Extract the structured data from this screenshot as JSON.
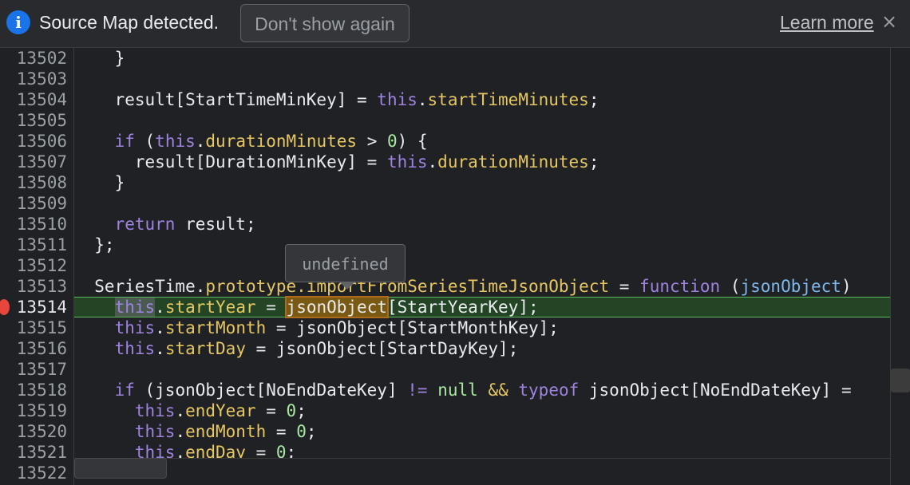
{
  "infobar": {
    "icon": "info-icon",
    "message": "Source Map detected.",
    "dont_show_label": "Don't show again",
    "learn_more_label": "Learn more",
    "close_glyph": "×"
  },
  "editor": {
    "current_line": "13514",
    "tooltip": "undefined",
    "line_numbers": [
      "13502",
      "13503",
      "13504",
      "13505",
      "13506",
      "13507",
      "13508",
      "13509",
      "13510",
      "13511",
      "13512",
      "13513",
      "13514",
      "13515",
      "13516",
      "13517",
      "13518",
      "13519",
      "13520",
      "13521",
      "13522"
    ],
    "lines": {
      "l13502": "    }",
      "l13504a": "    result[StartTimeMinKey] = ",
      "l13504b": "this",
      "l13504c": ".",
      "l13504d": "startTimeMinutes",
      "l13504e": ";",
      "l13506a": "    ",
      "l13506b": "if",
      "l13506c": " (",
      "l13506d": "this",
      "l13506e": ".",
      "l13506f": "durationMinutes",
      "l13506g": " > ",
      "l13506h": "0",
      "l13506i": ") {",
      "l13507a": "      result[DurationMinKey] = ",
      "l13507b": "this",
      "l13507c": ".",
      "l13507d": "durationMinutes",
      "l13507e": ";",
      "l13508": "    }",
      "l13510a": "    ",
      "l13510b": "return",
      "l13510c": " result;",
      "l13511": "  };",
      "l13513a": "  SeriesTime.",
      "l13513b": "prototype",
      "l13513c": ".importFromSeriesTimeJsonObject",
      "l13513d": " = ",
      "l13513e": "function",
      "l13513f": " (",
      "l13513g": "jsonObject",
      "l13513h": ")",
      "l13514a": "    ",
      "l13514b": "this",
      "l13514c": ".",
      "l13514d": "startYear",
      "l13514e": " = ",
      "l13514f": "jsonObject",
      "l13514g": "[StartYearKey];",
      "l13515a": "    ",
      "l13515b": "this",
      "l13515c": ".",
      "l13515d": "startMonth",
      "l13515e": " = jsonObject[StartMonthKey];",
      "l13516a": "    ",
      "l13516b": "this",
      "l13516c": ".",
      "l13516d": "startDay",
      "l13516e": " = jsonObject[StartDayKey];",
      "l13518a": "    ",
      "l13518b": "if",
      "l13518c": " (jsonObject[NoEndDateKey] ",
      "l13518d": "!=",
      "l13518e": " ",
      "l13518f": "null",
      "l13518g": " ",
      "l13518h": "&&",
      "l13518i": " ",
      "l13518j": "typeof",
      "l13518k": " jsonObject[NoEndDateKey] ",
      "l13518l": "=",
      "l13519a": "      ",
      "l13519b": "this",
      "l13519c": ".",
      "l13519d": "endYear",
      "l13519e": " = ",
      "l13519f": "0",
      "l13519g": ";",
      "l13520a": "      ",
      "l13520b": "this",
      "l13520c": ".",
      "l13520d": "endMonth",
      "l13520e": " = ",
      "l13520f": "0",
      "l13520g": ";",
      "l13521a": "      ",
      "l13521b": "this",
      "l13521c": ".",
      "l13521d": "endDay",
      "l13521e": " = ",
      "l13521f": "0",
      "l13521g": ";"
    }
  },
  "colors": {
    "keyword": "#9e83e0",
    "property": "#e6c761",
    "number": "#a8e9a0",
    "param": "#7fb8ee",
    "execution_highlight": "#234525",
    "breakpoint": "#e8453c",
    "info_accent": "#1a73e8"
  }
}
